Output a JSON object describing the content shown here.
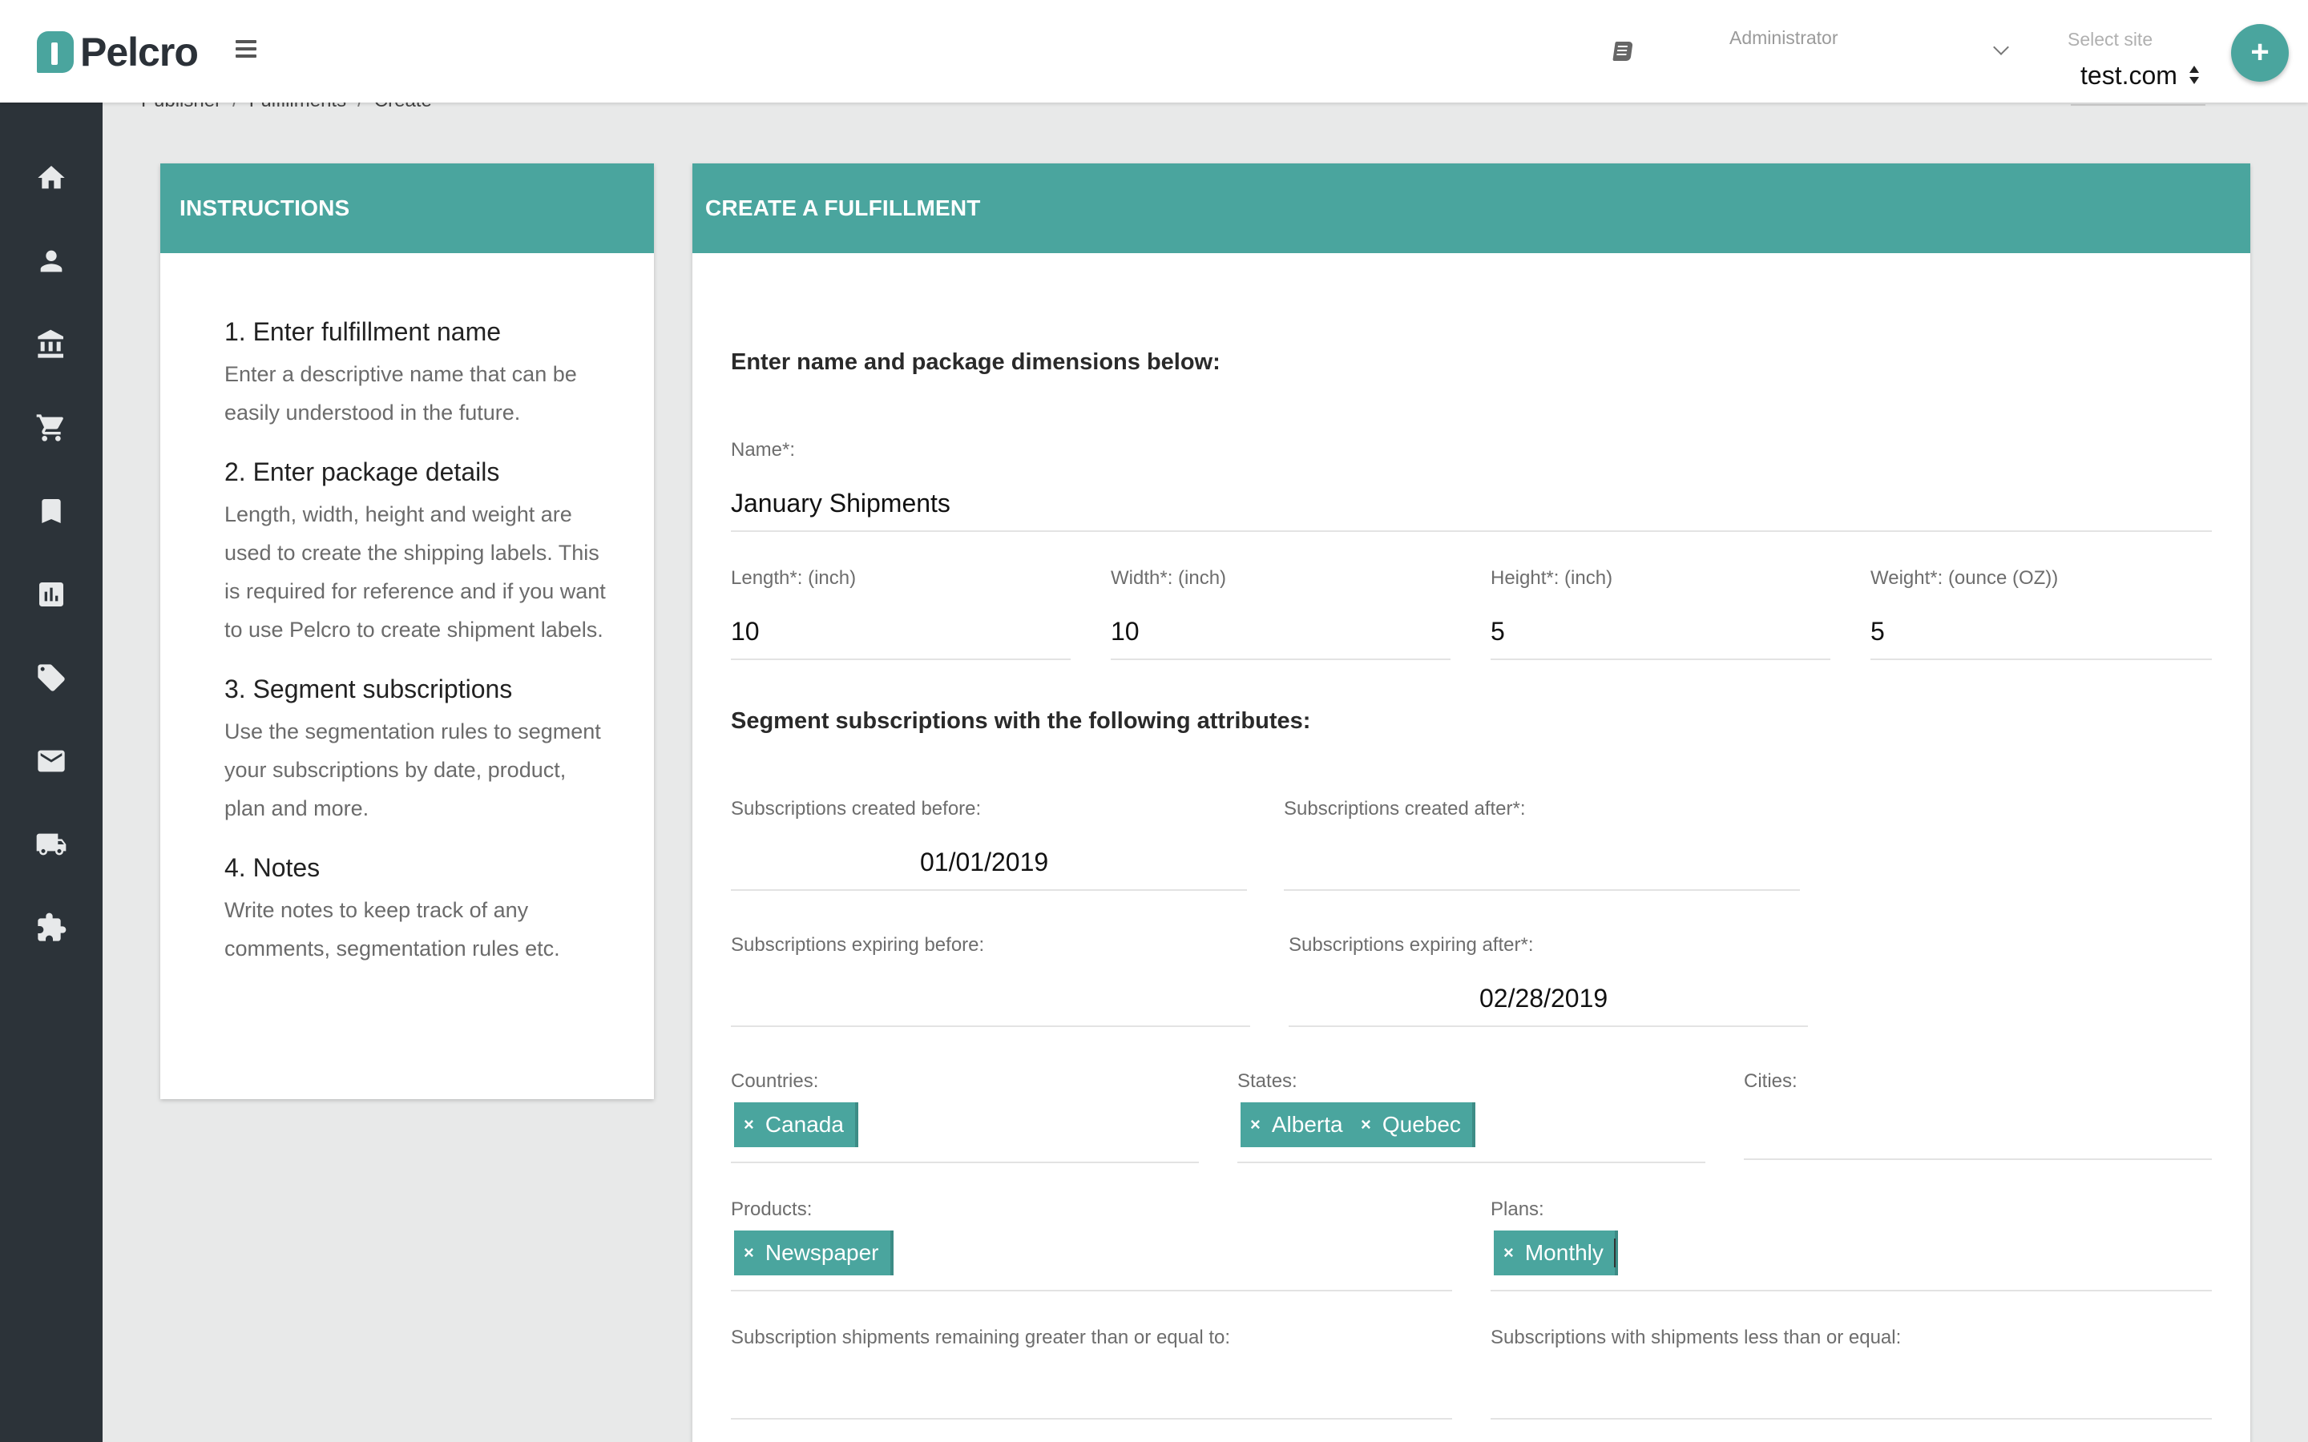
{
  "topbar": {
    "logo_text": "Pelcro",
    "role_label": "Administrator",
    "site_label": "Select site",
    "site_value": "test.com",
    "fab_label": "+"
  },
  "sidebar": {
    "items": [
      {
        "icon": "home-icon"
      },
      {
        "icon": "person-icon"
      },
      {
        "icon": "bank-icon"
      },
      {
        "icon": "cart-icon"
      },
      {
        "icon": "bookmark-icon"
      },
      {
        "icon": "chart-icon"
      },
      {
        "icon": "ticket-icon"
      },
      {
        "icon": "mail-icon"
      },
      {
        "icon": "truck-icon"
      },
      {
        "icon": "puzzle-icon"
      }
    ]
  },
  "breadcrumb": {
    "items": [
      "Publisher",
      "Fulfillments",
      "Create"
    ],
    "separator": "/"
  },
  "instructions": {
    "header": "INSTRUCTIONS",
    "steps": [
      {
        "title": "1. Enter fulfillment name",
        "text": "Enter a descriptive name that can be easily understood in the future."
      },
      {
        "title": "2. Enter package details",
        "text": "Length, width, height and weight are used to create the shipping labels. This is required for reference and if you want to use Pelcro to create shipment labels."
      },
      {
        "title": "3. Segment subscriptions",
        "text": "Use the segmentation rules to segment your subscriptions by date, product, plan and more."
      },
      {
        "title": "4. Notes",
        "text": "Write notes to keep track of any comments, segmentation rules etc."
      }
    ]
  },
  "form": {
    "header": "CREATE A FULFILLMENT",
    "section1": "Enter name and package dimensions below:",
    "name": {
      "label": "Name*:",
      "value": "January Shipments"
    },
    "length": {
      "label": "Length*: (inch)",
      "value": "10"
    },
    "width": {
      "label": "Width*: (inch)",
      "value": "10"
    },
    "height": {
      "label": "Height*: (inch)",
      "value": "5"
    },
    "weight": {
      "label": "Weight*: (ounce (OZ))",
      "value": "5"
    },
    "section2": "Segment subscriptions with the following attributes:",
    "created_before": {
      "label": "Subscriptions created before:",
      "value": "01/01/2019"
    },
    "created_after": {
      "label": "Subscriptions created after*:",
      "value": ""
    },
    "expiring_before": {
      "label": "Subscriptions expiring before:",
      "value": ""
    },
    "expiring_after": {
      "label": "Subscriptions expiring after*:",
      "value": "02/28/2019"
    },
    "countries": {
      "label": "Countries:",
      "chips": [
        "Canada"
      ]
    },
    "states": {
      "label": "States:",
      "chips": [
        "Alberta",
        "Quebec"
      ]
    },
    "cities": {
      "label": "Cities:",
      "chips": []
    },
    "products": {
      "label": "Products:",
      "chips": [
        "Newspaper"
      ]
    },
    "plans": {
      "label": "Plans:",
      "chips": [
        "Monthly"
      ]
    },
    "shipments_remaining": {
      "label": "Subscription shipments remaining greater than or equal to:",
      "value": ""
    },
    "shipments_less": {
      "label": "Subscriptions with shipments less than or equal:",
      "value": ""
    },
    "chip_remove_symbol": "×"
  },
  "colors": {
    "accent": "#4aa59e",
    "sidebar": "#2c3339",
    "background": "#e8e9e9"
  }
}
